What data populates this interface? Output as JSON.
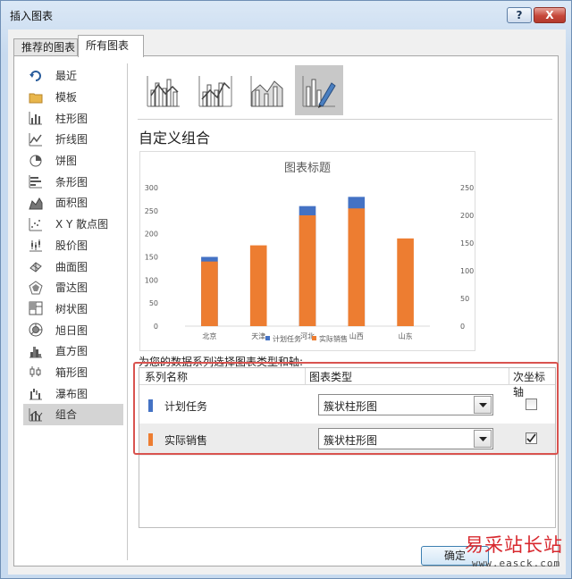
{
  "window": {
    "title": "插入图表",
    "help_label": "?",
    "close_label": "X"
  },
  "tabs": [
    {
      "label": "推荐的图表"
    },
    {
      "label": "所有图表"
    }
  ],
  "sidebar": {
    "items": [
      {
        "label": "最近",
        "icon": "recent-icon"
      },
      {
        "label": "模板",
        "icon": "folder-icon"
      },
      {
        "label": "柱形图",
        "icon": "column-chart-icon"
      },
      {
        "label": "折线图",
        "icon": "line-chart-icon"
      },
      {
        "label": "饼图",
        "icon": "pie-chart-icon"
      },
      {
        "label": "条形图",
        "icon": "bar-chart-icon"
      },
      {
        "label": "面积图",
        "icon": "area-chart-icon"
      },
      {
        "label": "X Y 散点图",
        "icon": "scatter-chart-icon"
      },
      {
        "label": "股价图",
        "icon": "stock-chart-icon"
      },
      {
        "label": "曲面图",
        "icon": "surface-chart-icon"
      },
      {
        "label": "雷达图",
        "icon": "radar-chart-icon"
      },
      {
        "label": "树状图",
        "icon": "treemap-chart-icon"
      },
      {
        "label": "旭日图",
        "icon": "sunburst-chart-icon"
      },
      {
        "label": "直方图",
        "icon": "histogram-chart-icon"
      },
      {
        "label": "箱形图",
        "icon": "box-whisker-chart-icon"
      },
      {
        "label": "瀑布图",
        "icon": "waterfall-chart-icon"
      },
      {
        "label": "组合",
        "icon": "combo-chart-icon"
      }
    ],
    "selected": "组合"
  },
  "combo_types": [
    {
      "icon": "clustered-column-line-icon"
    },
    {
      "icon": "clustered-column-line-secondary-icon"
    },
    {
      "icon": "stacked-area-column-icon"
    },
    {
      "icon": "custom-combination-icon"
    }
  ],
  "section_title": "自定义组合",
  "colors": {
    "plan": "#4472c4",
    "actual": "#ed7d31",
    "accent_red": "#d9534f"
  },
  "chart_data": {
    "type": "bar",
    "title": "图表标题",
    "categories": [
      "北京",
      "天津",
      "河北",
      "山西",
      "山东"
    ],
    "series": [
      {
        "name": "计划任务",
        "values": [
          150,
          0,
          260,
          280,
          0
        ],
        "color": "#4472c4"
      },
      {
        "name": "实际销售",
        "values": [
          140,
          175,
          240,
          255,
          190
        ],
        "color": "#ed7d31"
      }
    ],
    "ylim": [
      0,
      300
    ],
    "yticks": [
      "0",
      "50",
      "100",
      "150",
      "200",
      "250",
      "300"
    ],
    "y2lim": [
      0,
      250
    ],
    "y2ticks": [
      "0",
      "50",
      "100",
      "150",
      "200",
      "250"
    ],
    "legend": "bottom",
    "grid": false
  },
  "instruction": "为您的数据系列选择图表类型和轴:",
  "series_table": {
    "headers": {
      "name": "系列名称",
      "type": "图表类型",
      "secondary": "次坐标轴"
    },
    "rows": [
      {
        "name": "计划任务",
        "chart_type": "簇状柱形图",
        "secondary_axis": false
      },
      {
        "name": "实际销售",
        "chart_type": "簇状柱形图",
        "secondary_axis": true
      }
    ]
  },
  "buttons": {
    "ok": "确定"
  },
  "watermark": {
    "brand": "易采站长站",
    "url": "www.easck.com"
  }
}
